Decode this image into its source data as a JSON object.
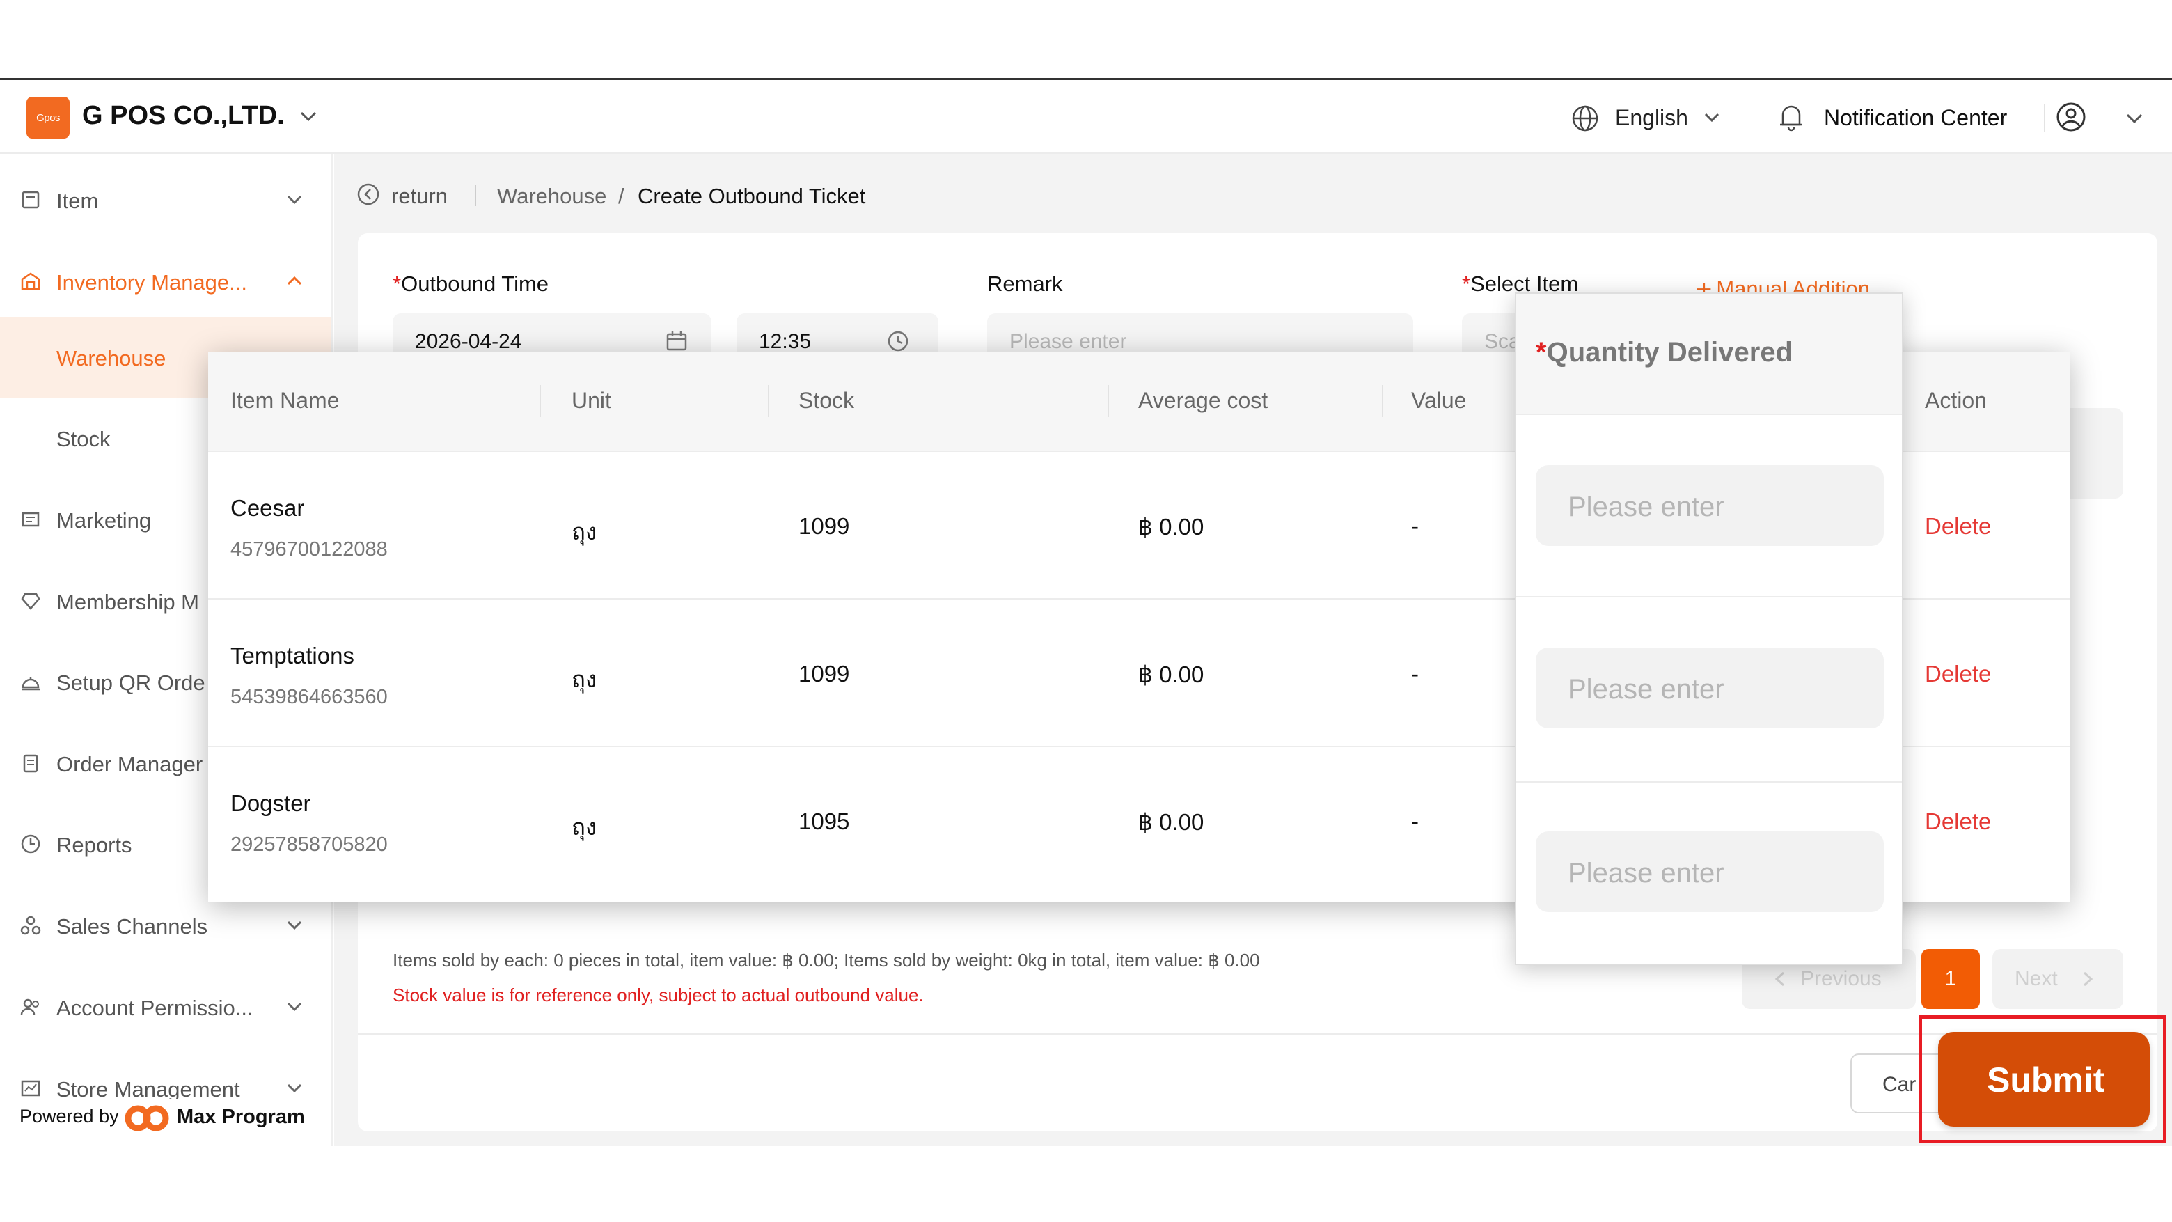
{
  "header": {
    "logo_text": "Gpos",
    "company": "G POS CO.,LTD.",
    "language": "English",
    "notification": "Notification Center"
  },
  "sidebar": {
    "items": [
      {
        "label": "Item",
        "icon": "item-icon"
      },
      {
        "label": "Inventory Manage...",
        "icon": "inventory-icon"
      },
      {
        "label": "Warehouse"
      },
      {
        "label": "Stock"
      },
      {
        "label": "Marketing",
        "icon": "marketing-icon"
      },
      {
        "label": "Membership M",
        "icon": "membership-icon"
      },
      {
        "label": "Setup QR Orde",
        "icon": "qr-order-icon"
      },
      {
        "label": "Order Manager",
        "icon": "order-icon"
      },
      {
        "label": "Reports",
        "icon": "reports-icon"
      },
      {
        "label": "Sales Channels",
        "icon": "sales-channels-icon"
      },
      {
        "label": "Account Permissio...",
        "icon": "account-icon"
      },
      {
        "label": "Store Management",
        "icon": "store-icon"
      }
    ],
    "powered_by": "Powered by",
    "brand": "Max Program"
  },
  "breadcrumb": {
    "return": "return",
    "parent": "Warehouse",
    "separator": "/",
    "current": "Create Outbound Ticket"
  },
  "form": {
    "outbound_time_label": "Outbound Time",
    "date_value": "2026-04-24",
    "time_value": "12:35",
    "remark_label": "Remark",
    "remark_placeholder": "Please enter",
    "select_item_label": "Select Item",
    "select_item_placeholder": "Sca",
    "manual_addition": "Manual Addition",
    "required_mark": "*"
  },
  "table": {
    "headers": [
      "Item Name",
      "Unit",
      "Stock",
      "Average cost",
      "Value",
      "Action"
    ],
    "rows": [
      {
        "name": "Ceesar",
        "code": "45796700122088",
        "unit": "ถุง",
        "stock": "1099",
        "avg_cost": "฿ 0.00",
        "value": "-",
        "action": "Delete"
      },
      {
        "name": "Temptations",
        "code": "54539864663560",
        "unit": "ถุง",
        "stock": "1099",
        "avg_cost": "฿ 0.00",
        "value": "-",
        "action": "Delete"
      },
      {
        "name": "Dogster",
        "code": "29257858705820",
        "unit": "ถุง",
        "stock": "1095",
        "avg_cost": "฿ 0.00",
        "value": "-",
        "action": "Delete"
      }
    ]
  },
  "quantity": {
    "title": "Quantity Delivered",
    "placeholders": [
      "Please enter",
      "Please enter",
      "Please enter"
    ]
  },
  "summary": "Items sold by each: 0 pieces in total, item value: ฿ 0.00; Items sold by weight: 0kg in total, item value: ฿ 0.00",
  "disclaimer": "Stock value is for reference only, subject to actual outbound value.",
  "pagination": {
    "previous": "Previous",
    "page": "1",
    "next": "Next"
  },
  "actions": {
    "cancel": "Car",
    "submit": "Submit"
  },
  "colors": {
    "accent": "#f26a21",
    "submit": "#d44d07",
    "delete": "#e53935",
    "highlight_frame": "#e81c24"
  }
}
